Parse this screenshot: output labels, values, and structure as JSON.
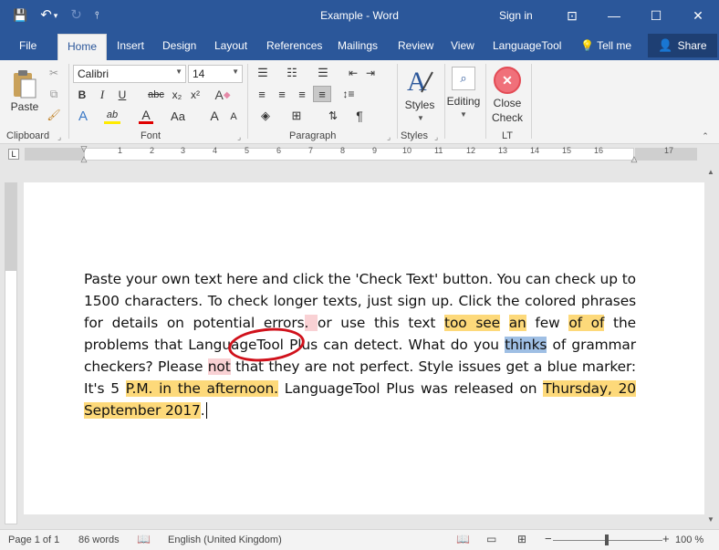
{
  "window": {
    "title": "Example  -  Word",
    "sign_in": "Sign in",
    "quick_access": {
      "save": "💾",
      "undo": "↶",
      "undo_arrow": "▾",
      "redo": "↻",
      "customize": "⫯"
    },
    "controls": {
      "ribbon_options": "⊡",
      "minimize": "—",
      "maximize": "☐",
      "close": "✕"
    }
  },
  "tabs": [
    {
      "label": "File"
    },
    {
      "label": "Home"
    },
    {
      "label": "Insert"
    },
    {
      "label": "Design"
    },
    {
      "label": "Layout"
    },
    {
      "label": "References"
    },
    {
      "label": "Mailings"
    },
    {
      "label": "Review"
    },
    {
      "label": "View"
    },
    {
      "label": "LanguageTool"
    },
    {
      "label": "Tell me"
    }
  ],
  "share_label": "Share",
  "ribbon": {
    "clipboard": {
      "label": "Clipboard",
      "paste": "Paste"
    },
    "font": {
      "label": "Font",
      "name": "Calibri",
      "size": "14",
      "bold": "B",
      "italic": "I",
      "underline": "U",
      "strike": "abc",
      "subscript": "x₂",
      "superscript": "x²",
      "clear": "A",
      "effects": "A",
      "highlight": "ab",
      "font_color": "A",
      "case": "Aa",
      "grow": "A",
      "shrink": "A"
    },
    "paragraph": {
      "label": "Paragraph",
      "pilcrow": "¶"
    },
    "styles": {
      "label": "Styles",
      "button": "Styles"
    },
    "editing": {
      "button": "Editing"
    },
    "lt": {
      "label": "LT",
      "close_line1": "Close",
      "close_line2": "Check"
    }
  },
  "ruler": {
    "numbers": [
      "1",
      "2",
      "3",
      "4",
      "5",
      "6",
      "7",
      "8",
      "9",
      "10",
      "11",
      "12",
      "13",
      "14",
      "15",
      "16",
      "17"
    ]
  },
  "document": {
    "segments": [
      {
        "text": "Paste your own text here and click the 'Check Text' button. You can check up to 1500 characters. To check longer texts, just sign up. Click the colored phrases for details on potential errors",
        "hl": ""
      },
      {
        "text": ". ",
        "hl": "p"
      },
      {
        "text": "or use this text ",
        "hl": ""
      },
      {
        "text": "too see",
        "hl": "y"
      },
      {
        "text": " ",
        "hl": ""
      },
      {
        "text": "an",
        "hl": "y"
      },
      {
        "text": " few ",
        "hl": ""
      },
      {
        "text": "of of",
        "hl": "y"
      },
      {
        "text": " the problems that LanguageTool Plus can detect. What do you ",
        "hl": ""
      },
      {
        "text": "thinks",
        "hl": "b"
      },
      {
        "text": " of grammar checkers? Please ",
        "hl": ""
      },
      {
        "text": "not",
        "hl": "p"
      },
      {
        "text": " that they are not perfect. Style issues get a blue marker: It's 5 ",
        "hl": ""
      },
      {
        "text": "P.M. in the afternoon.",
        "hl": "y"
      },
      {
        "text": " LanguageTool Plus was released on ",
        "hl": ""
      },
      {
        "text": "Thursday, 20 September 2017",
        "hl": "y"
      },
      {
        "text": ".",
        "hl": ""
      }
    ]
  },
  "status": {
    "page": "Page 1 of 1",
    "words": "86 words",
    "language": "English (United Kingdom)",
    "zoom": "100 %",
    "zoom_minus": "−",
    "zoom_plus": "+"
  },
  "colors": {
    "brand": "#2b579a",
    "highlight_yellow": "#fdd97a",
    "highlight_pink": "#f9d1d4",
    "highlight_blue": "#9fbfe4",
    "circle_red": "#d0111b"
  }
}
